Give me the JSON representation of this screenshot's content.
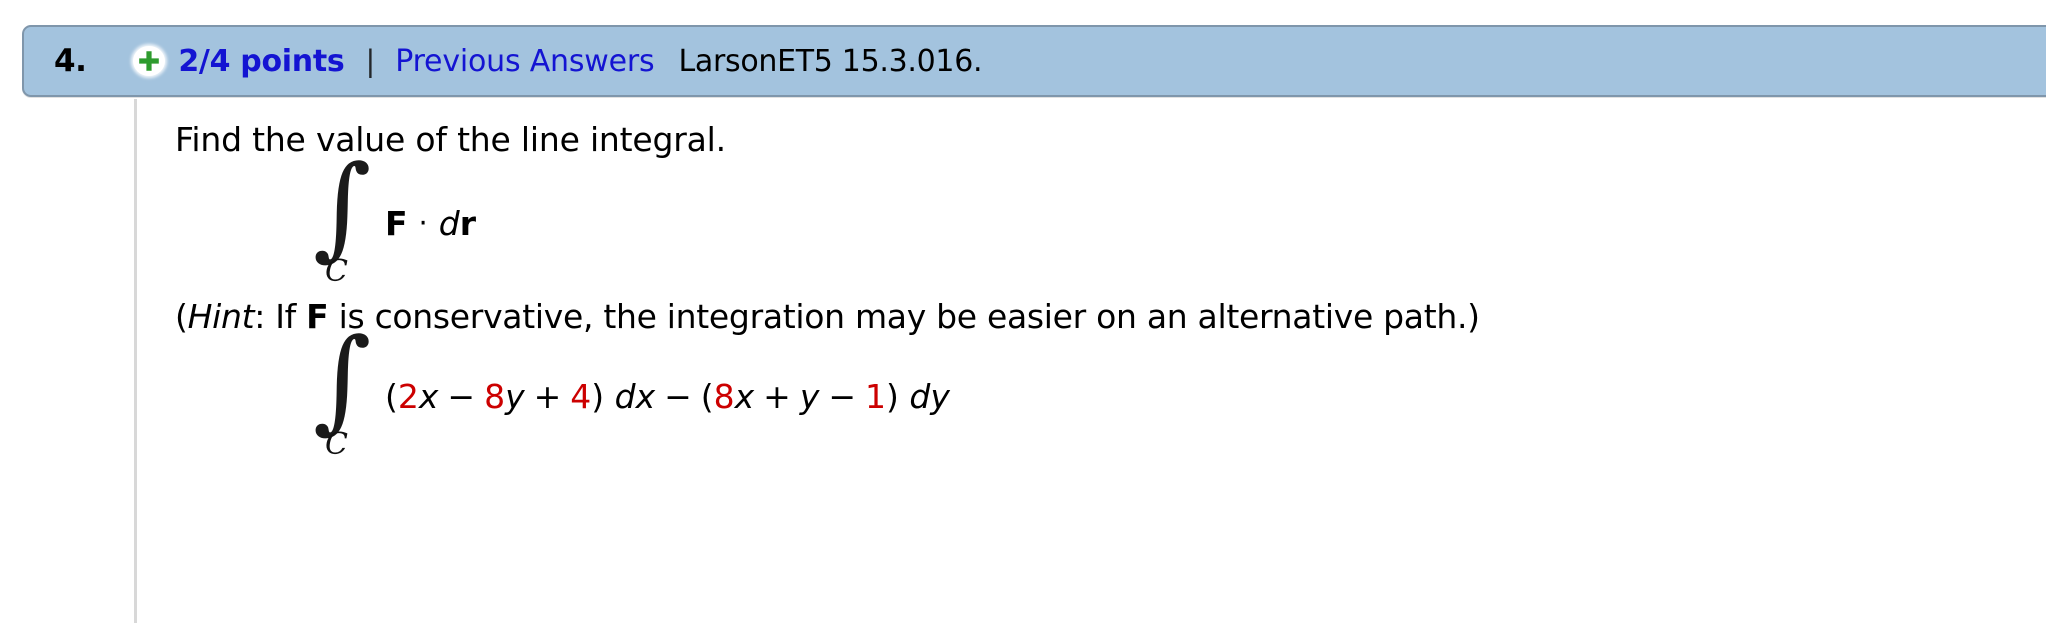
{
  "header": {
    "question_number": "4.",
    "status_icon": "green-plus-icon",
    "points": "2/4 points",
    "separator": "|",
    "previous_answers_link": "Previous Answers",
    "reference": "LarsonET5 15.3.016.",
    "colors": {
      "bar_background": "#a3c3de",
      "bar_border": "#7f96ab",
      "link_blue": "#1414d2",
      "plus_green": "#2e9b2e"
    }
  },
  "question": {
    "prompt": "Find the value of the line integral.",
    "integral_1": {
      "sign": "∫",
      "subscript": "C",
      "integrand_F": "F",
      "dot": "·",
      "d": "d",
      "r": "r"
    },
    "hint": {
      "open_paren": "(",
      "hint_word": "Hint",
      "colon_if": ": If ",
      "vector_F": "F",
      "rest": " is conservative, the integration may be easier on an alternative path.)"
    },
    "integral_2": {
      "sign": "∫",
      "subscript": "C",
      "open1": "(",
      "coef1": "2",
      "var1": "x",
      "op1": "−",
      "coef2": "8",
      "var2": "y",
      "op2": "+",
      "coef3": "4",
      "close1": ")",
      "dx": "dx",
      "op3": "−",
      "open2": "(",
      "coef4": "8",
      "var3": "x",
      "op4": "+",
      "var4": "y",
      "op5": "−",
      "coef5": "1",
      "close2": ")",
      "dy": "dy",
      "highlight_color": "#cc0000"
    }
  }
}
